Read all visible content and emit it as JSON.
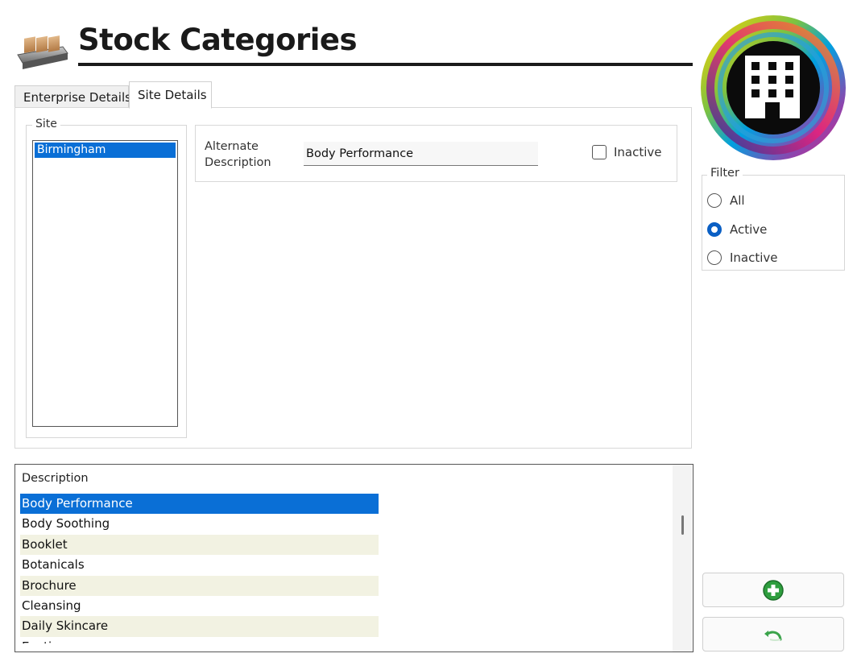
{
  "header": {
    "title": "Stock Categories",
    "app_icon": "stock-boxes-icon"
  },
  "logo": {
    "icon": "building-icon",
    "colors": [
      "#e8207a",
      "#f7941d",
      "#ffd200",
      "#7cc242",
      "#00a0e0",
      "#2e3192",
      "#8e44ad"
    ]
  },
  "tabs": [
    {
      "label": "Enterprise Details",
      "active": false
    },
    {
      "label": "Site Details",
      "active": true
    }
  ],
  "site_panel": {
    "legend": "Site",
    "sites": [
      "Birmingham"
    ],
    "selected": "Birmingham"
  },
  "details": {
    "alternate_description_label": "Alternate\nDescription",
    "alternate_description_value": "Body Performance",
    "inactive_label": "Inactive",
    "inactive_checked": false
  },
  "filter": {
    "legend": "Filter",
    "options": [
      "All",
      "Active",
      "Inactive"
    ],
    "selected": "Active"
  },
  "grid": {
    "header": "Description",
    "rows": [
      "Body Performance",
      "Body Soothing",
      "Booklet",
      "Botanicals",
      "Brochure",
      "Cleansing",
      "Daily Skincare",
      "Exotics"
    ],
    "selected": "Body Performance"
  },
  "actions": {
    "add_icon": "add-circle-icon",
    "undo_icon": "undo-icon",
    "accent": "#2e9e3e"
  }
}
